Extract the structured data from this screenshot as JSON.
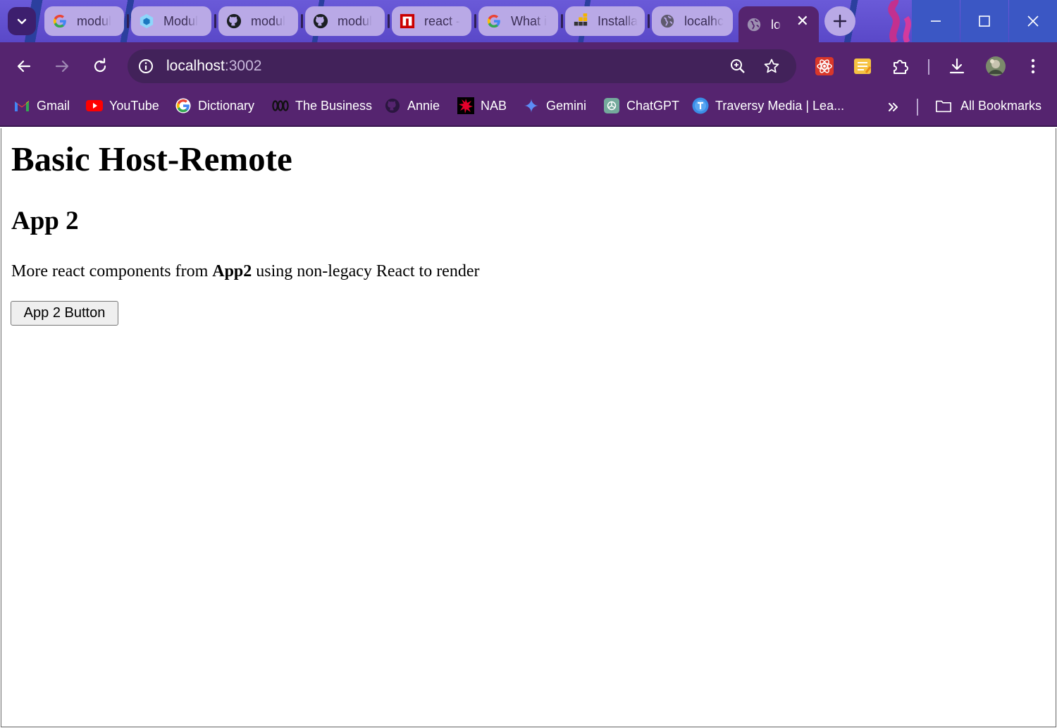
{
  "browser": {
    "tabs": [
      {
        "title": "modul",
        "icon": "google-icon"
      },
      {
        "title": "Modul",
        "icon": "webpack-icon"
      },
      {
        "title": "modul",
        "icon": "github-icon"
      },
      {
        "title": "modul",
        "icon": "github-icon"
      },
      {
        "title": "react -",
        "icon": "npm-icon"
      },
      {
        "title": "What i",
        "icon": "google-icon"
      },
      {
        "title": "Installa",
        "icon": "blocks-icon"
      },
      {
        "title": "localhc",
        "icon": "globe-icon"
      },
      {
        "title": "lo",
        "icon": "globe-icon",
        "active": true
      }
    ],
    "address": {
      "host": "localhost",
      "port": ":3002"
    },
    "bookmarks": [
      {
        "label": "Gmail",
        "icon": "gmail-icon"
      },
      {
        "label": "YouTube",
        "icon": "youtube-icon"
      },
      {
        "label": "Dictionary",
        "icon": "google-icon"
      },
      {
        "label": "The Business",
        "icon": "abc-icon"
      },
      {
        "label": "Annie",
        "icon": "github-icon"
      },
      {
        "label": "NAB",
        "icon": "nab-icon"
      },
      {
        "label": "Gemini",
        "icon": "gemini-icon"
      },
      {
        "label": "ChatGPT",
        "icon": "chatgpt-icon"
      },
      {
        "label": "Traversy Media | Lea...",
        "icon": "traversy-icon"
      }
    ],
    "all_bookmarks_label": "All Bookmarks",
    "theme": {
      "frame": "#55246f",
      "tab": "#b9a9e6",
      "accent": "#5a48c8"
    }
  },
  "page": {
    "heading": "Basic Host-Remote",
    "subheading": "App 2",
    "description_before": "More react components from ",
    "description_bold": "App2",
    "description_after": " using non-legacy React to render",
    "button_label": "App 2 Button"
  }
}
